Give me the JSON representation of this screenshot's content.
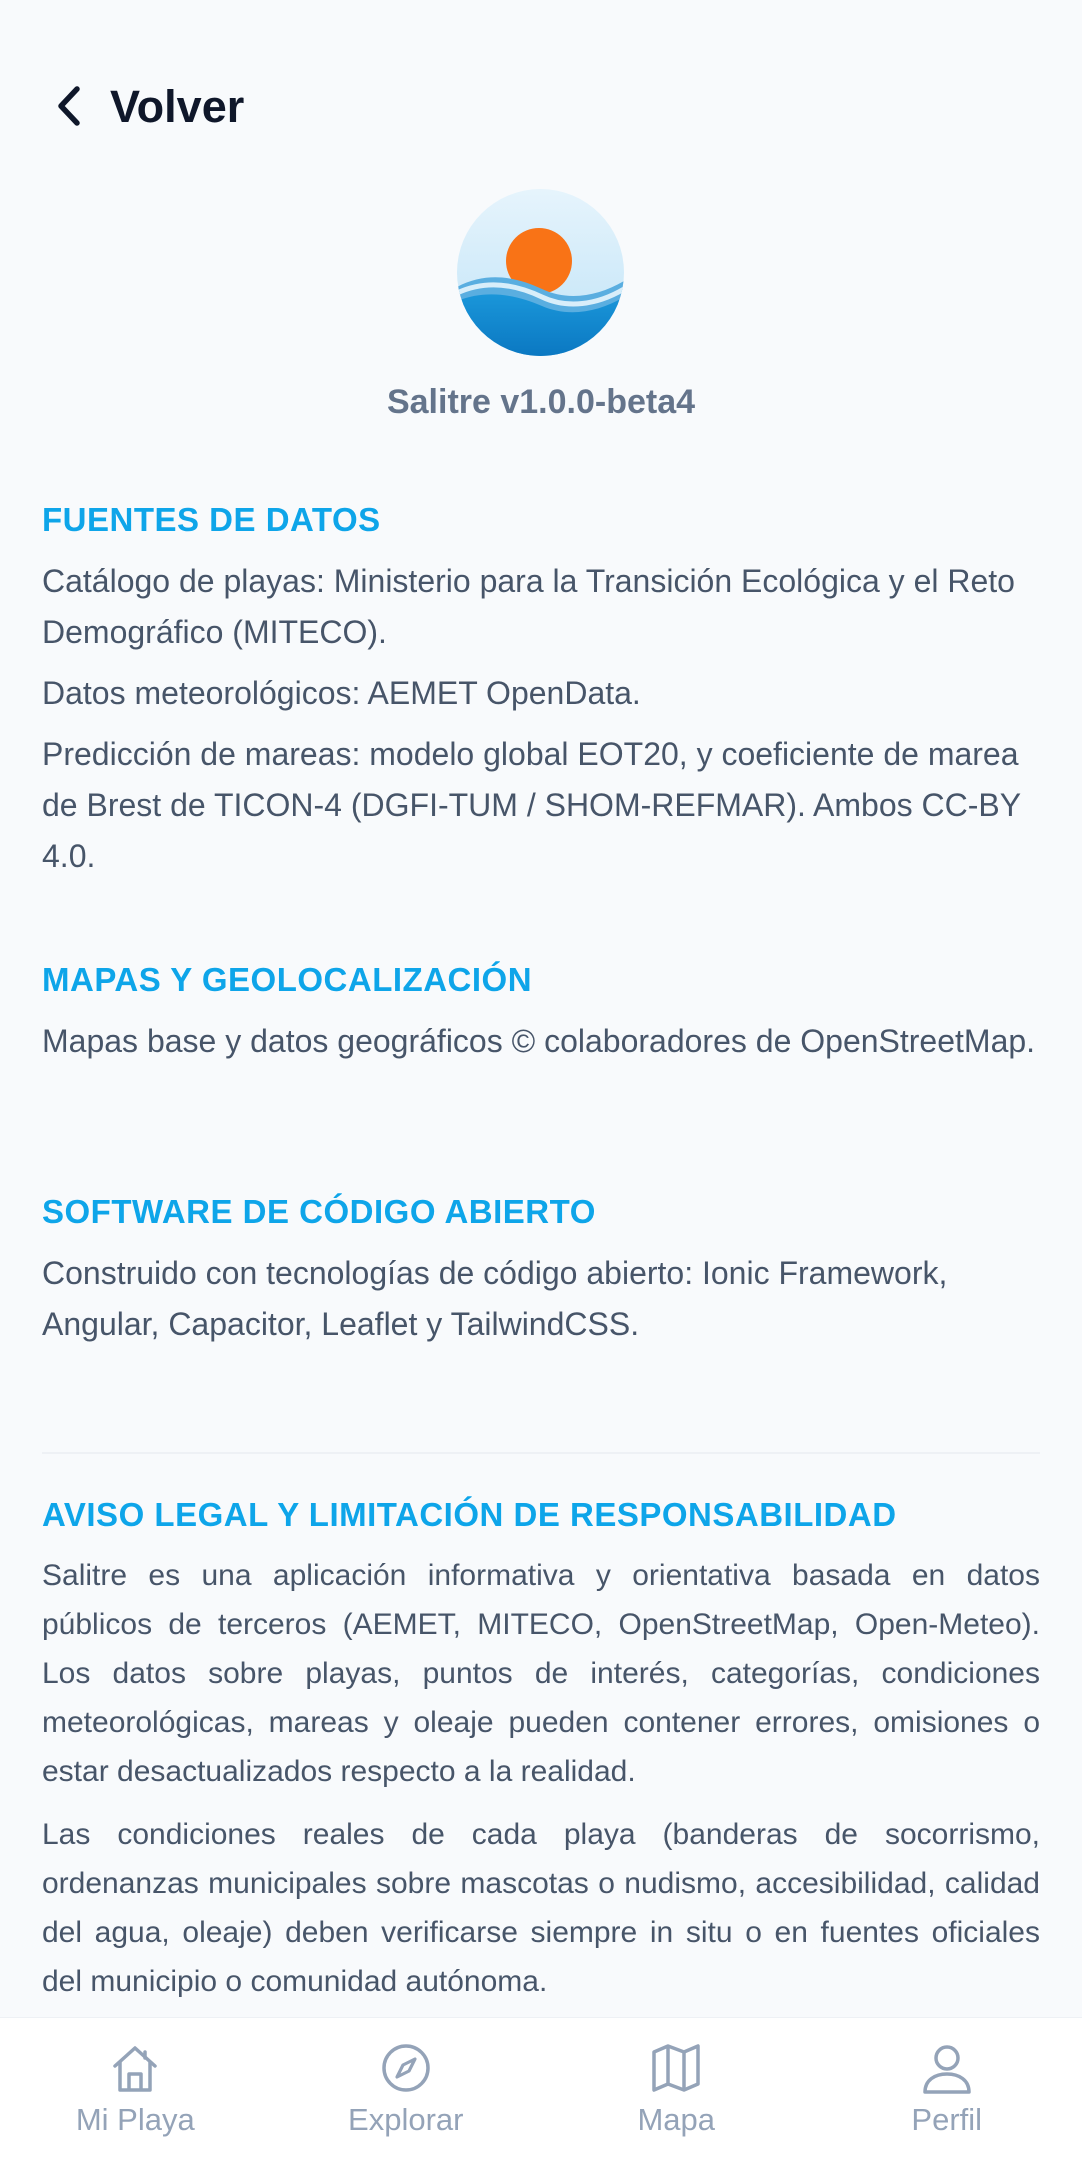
{
  "header": {
    "back_label": "Volver"
  },
  "app": {
    "version_label": "Salitre v1.0.0-beta4"
  },
  "sections": {
    "data_sources": {
      "title": "FUENTES DE DATOS",
      "p1": "Catálogo de playas: Ministerio para la Transición Ecológica y el Reto Demográfico (MITECO).",
      "p2": "Datos meteorológicos: AEMET OpenData.",
      "p3": "Predicción de mareas: modelo global EOT20, y coeficiente de marea de Brest de TICON-4 (DGFI-TUM / SHOM-REFMAR). Ambos CC-BY 4.0."
    },
    "maps": {
      "title": "MAPAS Y GEOLOCALIZACIÓN",
      "p1": "Mapas base y datos geográficos © colaboradores de OpenStreetMap."
    },
    "open_source": {
      "title": "SOFTWARE DE CÓDIGO ABIERTO",
      "p1": "Construido con tecnologías de código abierto: Ionic Framework, Angular, Capacitor, Leaflet y TailwindCSS."
    },
    "legal": {
      "title": "AVISO LEGAL Y LIMITACIÓN DE RESPONSABILIDAD",
      "p1": "Salitre es una aplicación informativa y orientativa basada en datos públicos de terceros (AEMET, MITECO, OpenStreetMap, Open-Meteo). Los datos sobre playas, puntos de interés, categorías, condiciones meteorológicas, mareas y oleaje pueden contener errores, omisiones o estar desactualizados respecto a la realidad.",
      "p2": "Las condiciones reales de cada playa (banderas de socorrismo, ordenanzas municipales sobre mascotas o nudismo, accesibilidad, calidad del agua, oleaje) deben verificarse siempre in situ o en fuentes oficiales del municipio o comunidad autónoma."
    }
  },
  "tabs": [
    {
      "label": "Mi Playa",
      "icon": "home-icon"
    },
    {
      "label": "Explorar",
      "icon": "compass-icon"
    },
    {
      "label": "Mapa",
      "icon": "map-icon"
    },
    {
      "label": "Perfil",
      "icon": "user-icon"
    }
  ],
  "colors": {
    "accent": "#0ea5e9",
    "text": "#475569",
    "title": "#0f172a",
    "inactive_tab": "#94a3b8",
    "background": "#f8fafc"
  }
}
